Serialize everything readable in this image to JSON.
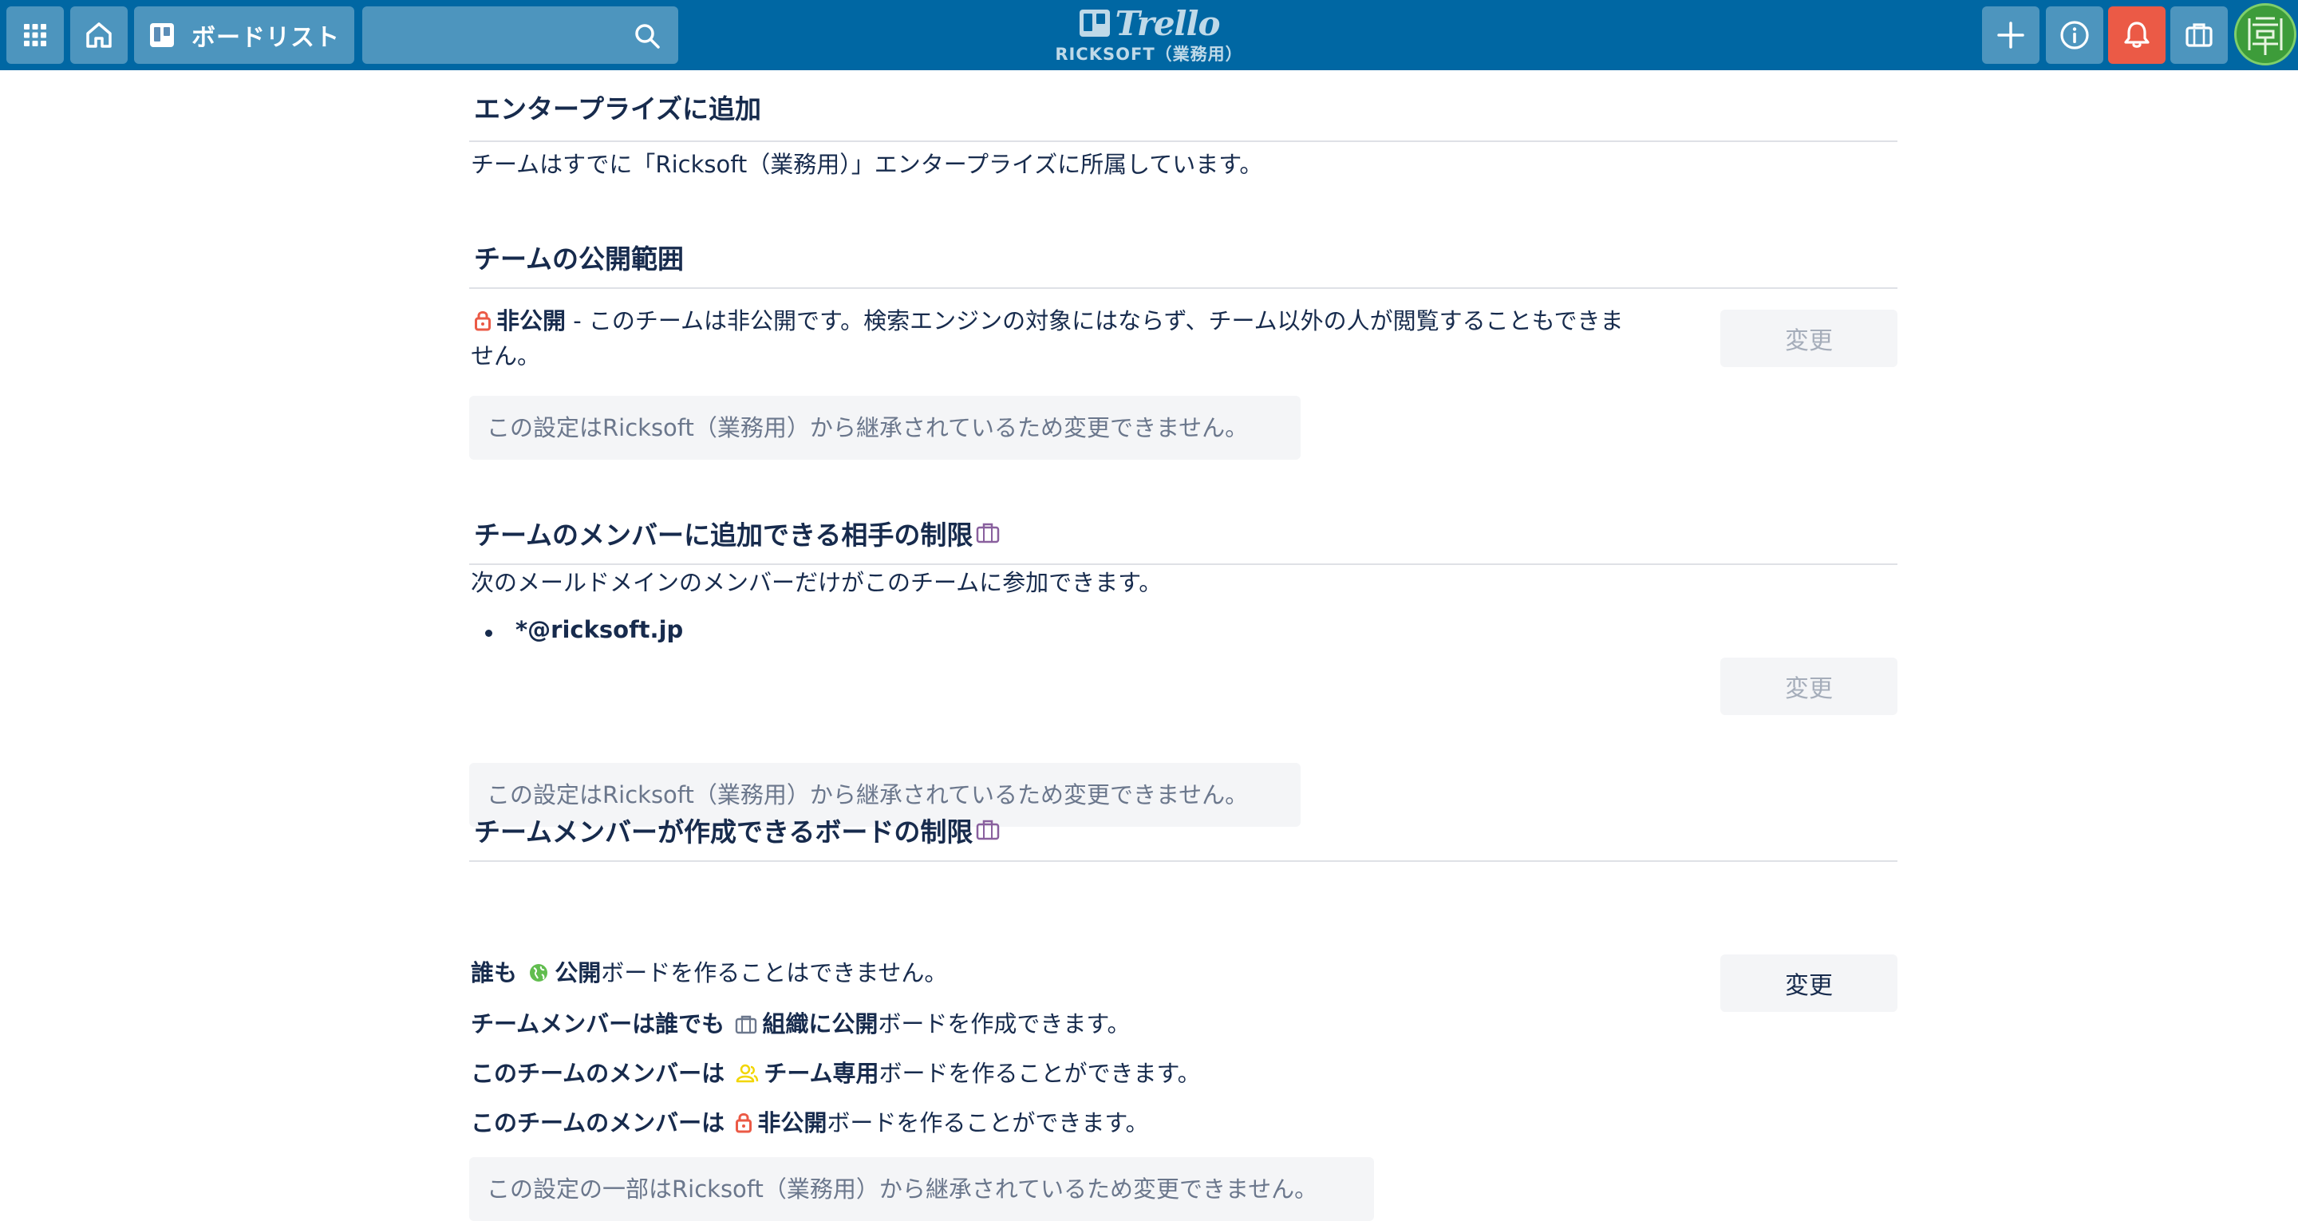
{
  "header": {
    "boards_label": "ボードリスト",
    "logo_text": "Trello",
    "workspace_name": "RICKSOFT（業務用）",
    "icons": [
      "apps-grid-icon",
      "home-icon",
      "boards-icon",
      "search-icon",
      "plus-icon",
      "info-icon",
      "bell-icon",
      "briefcase-icon",
      "avatar"
    ],
    "colors": {
      "header_bg": "#0067a3",
      "notification": "#eb5a46"
    }
  },
  "sections": {
    "enterprise": {
      "title": "エンタープライズに追加",
      "text": "チームはすでに「Ricksoft（業務用）」エンタープライズに所属しています。"
    },
    "visibility": {
      "title": "チームの公開範囲",
      "private_label": "非公開",
      "description_line1": " - このチームは非公開です。検索エンジンの対象にはならず、チーム以外の人が閲覧することもできま",
      "description_line2": "せん。",
      "change_label": "変更",
      "note": "この設定はRicksoft（業務用）から継承されているため変更できません。"
    },
    "membership": {
      "title": "チームのメンバーに追加できる相手の制限",
      "text": "次のメールドメインのメンバーだけがこのチームに参加できます。",
      "domains": [
        "*@ricksoft.jp"
      ],
      "change_label": "変更",
      "note": "この設定はRicksoft（業務用）から継承されているため変更できません。"
    },
    "board_creation": {
      "title": "チームメンバーが作成できるボードの制限",
      "change_label": "変更",
      "line1_bold": "誰も",
      "line1_type": "公開",
      "line1_rest": "ボードを作ることはできません。",
      "line2_bold": "チームメンバーは誰でも",
      "line2_type": "組織に公開",
      "line2_rest": "ボードを作成できます。",
      "line3_bold": "このチームのメンバーは",
      "line3_type": "チーム専用",
      "line3_rest": "ボードを作ることができます。",
      "line4_bold": "このチームのメンバーは",
      "line4_type": "非公開",
      "line4_rest": "ボードを作ることができます。",
      "note": "この設定の一部はRicksoft（業務用）から継承されているため変更できません。"
    }
  }
}
